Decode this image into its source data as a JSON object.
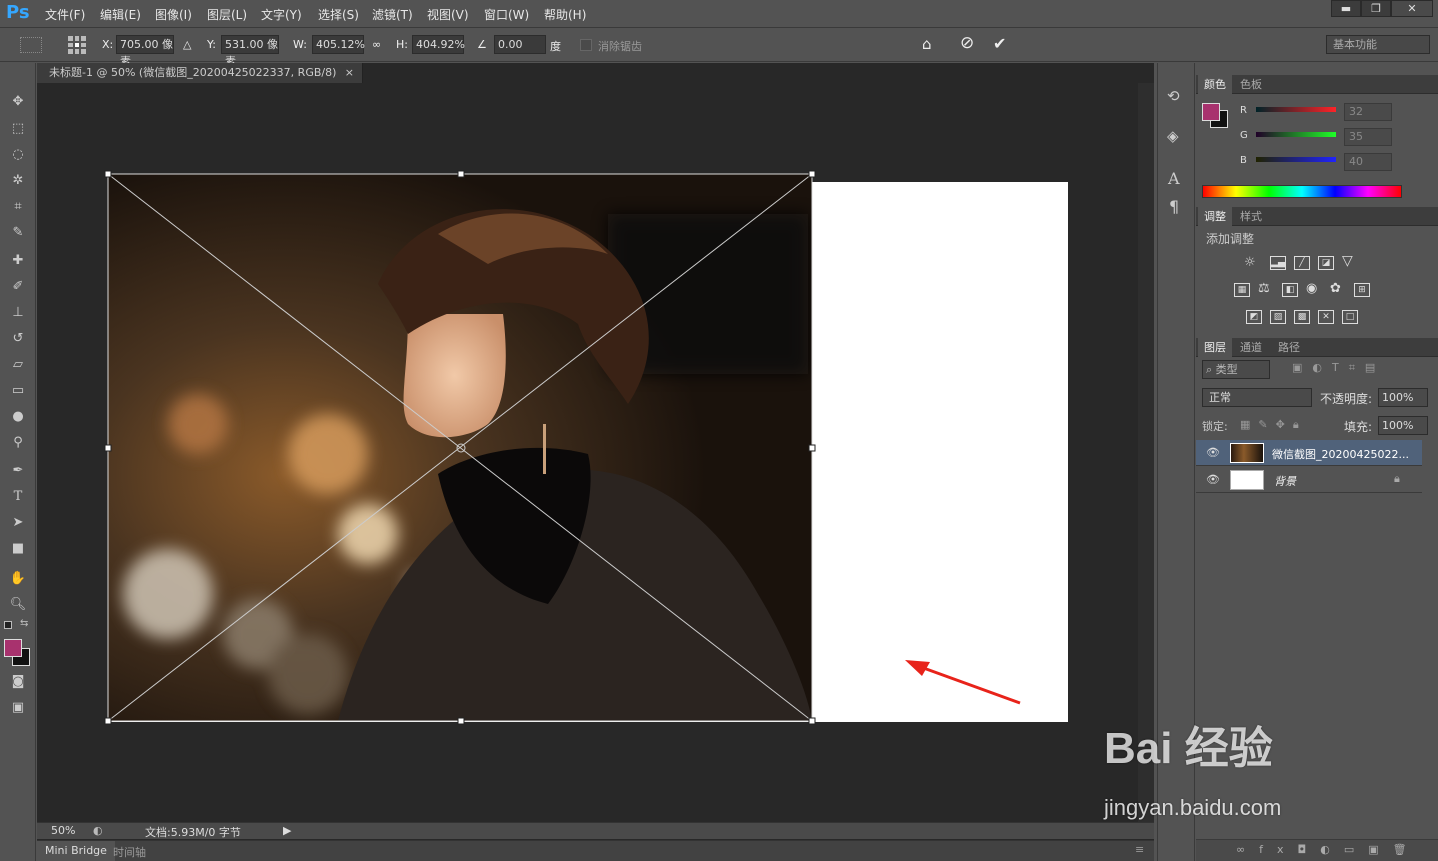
{
  "app": {
    "logo": "Ps"
  },
  "menu": [
    "文件(F)",
    "编辑(E)",
    "图像(I)",
    "图层(L)",
    "文字(Y)",
    "选择(S)",
    "滤镜(T)",
    "视图(V)",
    "窗口(W)",
    "帮助(H)"
  ],
  "window_controls": {
    "minimize": "▬",
    "restore": "❐",
    "close": "✕"
  },
  "options": {
    "x_label": "X:",
    "x_value": "705.00 像素",
    "y_label": "Y:",
    "y_value": "531.00 像素",
    "w_label": "W:",
    "w_value": "405.12%",
    "h_label": "H:",
    "h_value": "404.92%",
    "angle_value": "0.00",
    "angle_unit": "度",
    "antialias_label": "消除锯齿",
    "workspace": "基本功能"
  },
  "document": {
    "tab_title": "未标题-1 @ 50% (微信截图_20200425022337, RGB/8)",
    "zoom": "50%",
    "doc_info": "文档:5.93M/0 字节"
  },
  "bottom_tabs": [
    "Mini Bridge",
    "时间轴"
  ],
  "color_panel": {
    "tabs": [
      "颜色",
      "色板"
    ],
    "r_label": "R",
    "r_value": "32",
    "g_label": "G",
    "g_value": "35",
    "b_label": "B",
    "b_value": "40",
    "foreground_color": "#a8326e"
  },
  "adjust_panel": {
    "tabs": [
      "调整",
      "样式"
    ],
    "title": "添加调整"
  },
  "layers_panel": {
    "tabs": [
      "图层",
      "通道",
      "路径"
    ],
    "filter": "类型",
    "blend_mode": "正常",
    "opacity_label": "不透明度:",
    "opacity_value": "100%",
    "lock_label": "锁定:",
    "fill_label": "填充:",
    "fill_value": "100%",
    "layers": [
      {
        "name": "微信截图_20200425022..."
      },
      {
        "name": "背景"
      }
    ]
  },
  "watermark": {
    "brand": "Bai 经验",
    "url": "jingyan.baidu.com"
  }
}
